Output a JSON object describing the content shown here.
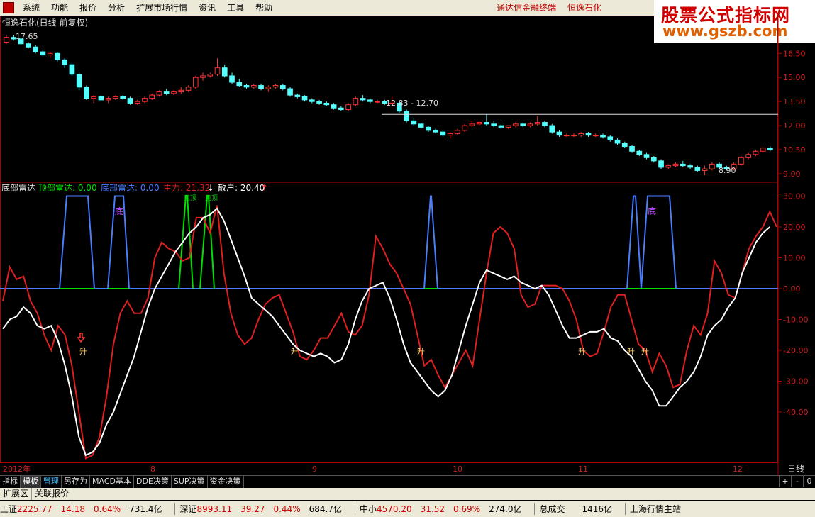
{
  "menu": {
    "items": [
      "系统",
      "功能",
      "报价",
      "分析",
      "扩展市场行情",
      "资讯",
      "工具",
      "帮助"
    ],
    "right": [
      "通达信金融终端",
      "恒逸石化"
    ]
  },
  "watermark": {
    "line1": "股票公式指标网",
    "line2": "www.gszb.com"
  },
  "colors": {
    "up": "#ff3232",
    "down": "#54ffff",
    "white_line": "#ffffff",
    "red_line": "#e02020",
    "blue_line": "#4a7dff",
    "green_line": "#00e000"
  },
  "price_panel": {
    "title": "恒逸石化(日线 前复权)",
    "high_label": "17.65",
    "low_label": "8.90",
    "range_label": "12.83 - 12.70",
    "y_ticks": [
      "16.50",
      "15.00",
      "13.50",
      "12.00",
      "10.50",
      "9.00"
    ]
  },
  "indicator_panel": {
    "name": "底部雷达",
    "top_label": "顶部雷达: 0.00",
    "bottom_label": "底部雷达: 0.00",
    "main_label": "主力: 21.32",
    "main_arrow": "↓",
    "retail_label": "散户: 20.40",
    "retail_arrow": "↑",
    "y_ticks": [
      "30.00",
      "20.00",
      "10.00",
      "0.00",
      "-10.00",
      "-20.00",
      "-30.00",
      "-40.00"
    ],
    "markers": [
      "底",
      "底",
      "升",
      "升",
      "升",
      "升",
      "升",
      "升"
    ],
    "peak_text": "见顶"
  },
  "x_axis": {
    "labels": [
      "2012年",
      "8",
      "9",
      "10",
      "11",
      "12"
    ],
    "period": "日线"
  },
  "bottom_tabs": [
    "指标",
    "模板",
    "管理",
    "另存为",
    "MACD基本",
    "DDE决策",
    "SUP决策",
    "资金决策"
  ],
  "bottom_ctrl": [
    "+",
    "-",
    "0"
  ],
  "ext_bar": [
    "扩展区",
    "关联报价"
  ],
  "status": {
    "sh": {
      "name": "上证",
      "value": "2225.77",
      "chg": "14.18",
      "pct": "0.64%",
      "amt": "731.4亿"
    },
    "sz": {
      "name": "深证",
      "value": "8993.11",
      "chg": "39.27",
      "pct": "0.44%",
      "amt": "684.7亿"
    },
    "zx": {
      "name": "中小",
      "value": "4570.20",
      "chg": "31.52",
      "pct": "0.69%",
      "amt": "274.0亿"
    },
    "total": {
      "name": "总成交",
      "amt": "1416亿"
    },
    "site": "上海行情主站"
  },
  "chart_data": {
    "type": "line",
    "candles": [
      [
        17.2,
        17.6,
        17.1,
        17.5
      ],
      [
        17.5,
        17.65,
        17.3,
        17.4
      ],
      [
        17.4,
        17.5,
        17.0,
        17.1
      ],
      [
        17.1,
        17.2,
        16.8,
        16.9
      ],
      [
        16.9,
        17.0,
        16.5,
        16.6
      ],
      [
        16.6,
        16.7,
        16.3,
        16.4
      ],
      [
        16.4,
        16.6,
        16.2,
        16.5
      ],
      [
        16.5,
        16.6,
        16.0,
        16.1
      ],
      [
        16.1,
        16.2,
        15.6,
        15.8
      ],
      [
        15.8,
        15.9,
        15.1,
        15.2
      ],
      [
        15.2,
        15.3,
        14.2,
        14.4
      ],
      [
        14.4,
        14.5,
        13.6,
        13.7
      ],
      [
        13.7,
        13.9,
        13.4,
        13.8
      ],
      [
        13.8,
        13.9,
        13.5,
        13.6
      ],
      [
        13.6,
        13.8,
        13.4,
        13.7
      ],
      [
        13.7,
        13.9,
        13.6,
        13.8
      ],
      [
        13.8,
        13.9,
        13.6,
        13.7
      ],
      [
        13.7,
        13.8,
        13.3,
        13.4
      ],
      [
        13.4,
        13.6,
        13.3,
        13.5
      ],
      [
        13.5,
        13.8,
        13.4,
        13.7
      ],
      [
        13.7,
        14.0,
        13.6,
        13.9
      ],
      [
        13.9,
        14.2,
        13.8,
        14.1
      ],
      [
        14.1,
        14.3,
        13.9,
        14.0
      ],
      [
        14.0,
        14.2,
        13.9,
        14.1
      ],
      [
        14.1,
        14.4,
        14.0,
        14.2
      ],
      [
        14.2,
        14.5,
        14.1,
        14.4
      ],
      [
        14.4,
        15.1,
        14.3,
        15.0
      ],
      [
        15.0,
        15.3,
        14.8,
        15.1
      ],
      [
        15.1,
        15.3,
        15.0,
        15.2
      ],
      [
        15.2,
        16.2,
        15.1,
        15.6
      ],
      [
        15.6,
        15.8,
        15.0,
        15.1
      ],
      [
        15.1,
        15.3,
        14.6,
        14.7
      ],
      [
        14.7,
        14.9,
        14.4,
        14.5
      ],
      [
        14.5,
        14.6,
        14.3,
        14.4
      ],
      [
        14.4,
        14.6,
        14.3,
        14.5
      ],
      [
        14.5,
        14.6,
        14.2,
        14.3
      ],
      [
        14.3,
        14.5,
        14.1,
        14.4
      ],
      [
        14.4,
        14.6,
        14.3,
        14.5
      ],
      [
        14.5,
        14.6,
        14.2,
        14.3
      ],
      [
        14.3,
        14.4,
        13.8,
        13.9
      ],
      [
        13.9,
        14.0,
        13.7,
        13.8
      ],
      [
        13.8,
        13.9,
        13.5,
        13.6
      ],
      [
        13.6,
        13.7,
        13.4,
        13.5
      ],
      [
        13.5,
        13.6,
        13.3,
        13.4
      ],
      [
        13.4,
        13.5,
        13.2,
        13.3
      ],
      [
        13.3,
        13.4,
        13.0,
        13.1
      ],
      [
        13.1,
        13.2,
        12.9,
        13.0
      ],
      [
        13.0,
        13.4,
        12.9,
        13.3
      ],
      [
        13.3,
        13.8,
        13.2,
        13.7
      ],
      [
        13.7,
        13.9,
        13.5,
        13.6
      ],
      [
        13.6,
        13.7,
        13.4,
        13.5
      ],
      [
        13.5,
        13.6,
        13.4,
        13.5
      ],
      [
        13.5,
        13.6,
        13.3,
        13.4
      ],
      [
        13.4,
        13.8,
        13.3,
        13.4
      ],
      [
        13.4,
        13.5,
        12.8,
        12.9
      ],
      [
        12.9,
        13.0,
        12.2,
        12.3
      ],
      [
        12.3,
        12.5,
        12.0,
        12.1
      ],
      [
        12.1,
        12.2,
        11.8,
        11.9
      ],
      [
        11.9,
        12.0,
        11.6,
        11.7
      ],
      [
        11.7,
        11.8,
        11.5,
        11.6
      ],
      [
        11.6,
        11.7,
        11.3,
        11.4
      ],
      [
        11.4,
        11.6,
        11.2,
        11.5
      ],
      [
        11.5,
        11.8,
        11.4,
        11.7
      ],
      [
        11.7,
        12.1,
        11.6,
        12.0
      ],
      [
        12.0,
        12.3,
        11.9,
        12.1
      ],
      [
        12.1,
        12.3,
        12.0,
        12.2
      ],
      [
        12.2,
        12.7,
        12.0,
        12.1
      ],
      [
        12.1,
        12.3,
        11.9,
        12.0
      ],
      [
        12.0,
        12.1,
        11.8,
        11.9
      ],
      [
        11.9,
        12.0,
        11.8,
        12.0
      ],
      [
        12.0,
        12.2,
        11.9,
        12.1
      ],
      [
        12.1,
        12.2,
        11.9,
        12.0
      ],
      [
        12.0,
        12.2,
        11.9,
        12.1
      ],
      [
        12.1,
        12.6,
        12.0,
        12.2
      ],
      [
        12.2,
        12.3,
        11.9,
        12.0
      ],
      [
        12.0,
        12.1,
        11.5,
        11.6
      ],
      [
        11.6,
        11.7,
        11.3,
        11.4
      ],
      [
        11.4,
        11.5,
        11.3,
        11.4
      ],
      [
        11.4,
        11.5,
        11.3,
        11.4
      ],
      [
        11.4,
        11.6,
        11.3,
        11.5
      ],
      [
        11.5,
        11.6,
        11.3,
        11.4
      ],
      [
        11.4,
        11.5,
        11.3,
        11.4
      ],
      [
        11.4,
        11.5,
        11.2,
        11.3
      ],
      [
        11.3,
        11.4,
        11.0,
        11.1
      ],
      [
        11.1,
        11.2,
        10.8,
        10.9
      ],
      [
        10.9,
        11.0,
        10.6,
        10.7
      ],
      [
        10.7,
        10.8,
        10.3,
        10.4
      ],
      [
        10.4,
        10.5,
        10.1,
        10.2
      ],
      [
        10.2,
        10.3,
        9.9,
        10.0
      ],
      [
        10.0,
        10.1,
        9.7,
        9.8
      ],
      [
        9.8,
        9.9,
        9.3,
        9.4
      ],
      [
        9.4,
        9.6,
        9.3,
        9.5
      ],
      [
        9.5,
        9.7,
        9.4,
        9.6
      ],
      [
        9.6,
        9.8,
        9.4,
        9.5
      ],
      [
        9.5,
        9.6,
        9.3,
        9.4
      ],
      [
        9.4,
        9.5,
        9.1,
        9.2
      ],
      [
        9.2,
        9.5,
        8.9,
        9.3
      ],
      [
        9.3,
        9.7,
        9.2,
        9.6
      ],
      [
        9.6,
        9.7,
        9.3,
        9.4
      ],
      [
        9.4,
        9.5,
        9.2,
        9.3
      ],
      [
        9.3,
        9.7,
        9.2,
        9.6
      ],
      [
        9.6,
        10.1,
        9.5,
        10.0
      ],
      [
        10.0,
        10.3,
        9.9,
        10.2
      ],
      [
        10.2,
        10.5,
        10.1,
        10.4
      ],
      [
        10.4,
        10.7,
        10.3,
        10.6
      ],
      [
        10.6,
        10.7,
        10.4,
        10.5
      ]
    ],
    "red_line": [
      -4,
      7,
      3,
      4,
      -4,
      -8,
      -15,
      -20,
      -12,
      -15,
      -25,
      -40,
      -55,
      -54,
      -48,
      -35,
      -18,
      -8,
      -4,
      -8,
      -8,
      -3,
      10,
      15,
      13,
      12,
      9,
      10,
      23,
      23,
      18,
      27,
      5,
      -8,
      -15,
      -18,
      -16,
      -10,
      -5,
      -3,
      -2,
      -8,
      -14,
      -22,
      -23,
      -20,
      -16,
      -16,
      -12,
      -8,
      -14,
      -15,
      -12,
      -2,
      17,
      13,
      8,
      5,
      0,
      -5,
      -15,
      -25,
      -23,
      -28,
      -32,
      -28,
      -24,
      -20,
      -25,
      -10,
      5,
      18,
      20,
      18,
      13,
      -2,
      -6,
      -5,
      1,
      1,
      1,
      0,
      -4,
      -10,
      -20,
      -22,
      -21,
      -14,
      -6,
      -2,
      -2,
      -10,
      -18,
      -20,
      -27,
      -21,
      -25,
      -32,
      -31,
      -20,
      -12,
      -15,
      -8,
      9,
      5,
      -2,
      -3,
      5,
      13,
      17,
      20,
      25,
      20
    ],
    "white_line": [
      -13,
      -10,
      -9,
      -6,
      -8,
      -12,
      -13,
      -12,
      -17,
      -25,
      -35,
      -48,
      -54,
      -53,
      -50,
      -44,
      -40,
      -34,
      -28,
      -22,
      -14,
      -6,
      0,
      4,
      8,
      12,
      15,
      18,
      20,
      23,
      24,
      26,
      22,
      16,
      10,
      4,
      -3,
      -5,
      -7,
      -9,
      -12,
      -15,
      -18,
      -20,
      -21,
      -22,
      -21,
      -22,
      -24,
      -23,
      -18,
      -10,
      -4,
      0,
      1,
      2,
      -3,
      -10,
      -18,
      -24,
      -27,
      -30,
      -33,
      -35,
      -33,
      -28,
      -20,
      -12,
      -5,
      2,
      6,
      5,
      4,
      3,
      4,
      2,
      1,
      0,
      1,
      -2,
      -7,
      -12,
      -16,
      -16,
      -15,
      -14,
      -14,
      -13,
      -16,
      -17,
      -20,
      -22,
      -26,
      -30,
      -33,
      -38,
      -38,
      -35,
      -32,
      -30,
      -27,
      -22,
      -15,
      -12,
      -10,
      -6,
      -3,
      5,
      10,
      15,
      18,
      20
    ]
  }
}
